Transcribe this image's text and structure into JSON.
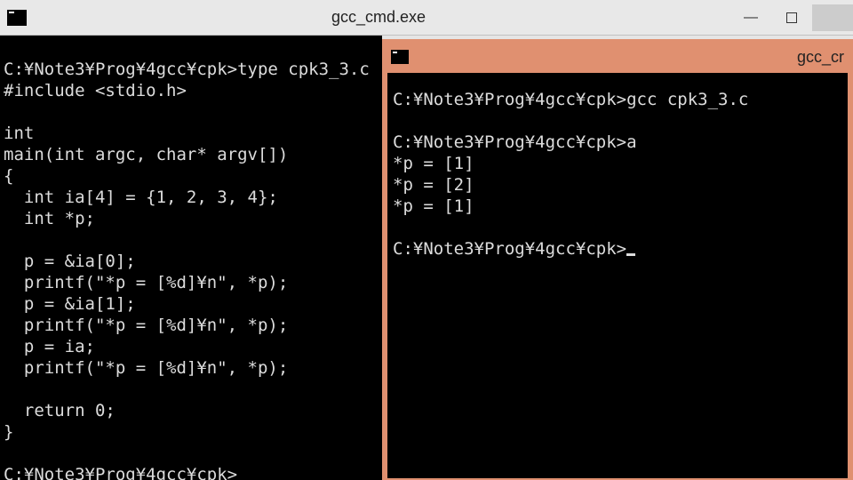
{
  "window1": {
    "title": "gcc_cmd.exe"
  },
  "window2": {
    "title": "gcc_cr"
  },
  "left": {
    "l0": "",
    "l1": "C:¥Note3¥Prog¥4gcc¥cpk>type cpk3_3.c",
    "l2": "#include <stdio.h>",
    "l3": "",
    "l4": "int",
    "l5": "main(int argc, char* argv[])",
    "l6": "{",
    "l7": "  int ia[4] = {1, 2, 3, 4};",
    "l8": "  int *p;",
    "l9": "",
    "l10": "  p = &ia[0];",
    "l11": "  printf(\"*p = [%d]¥n\", *p);",
    "l12": "  p = &ia[1];",
    "l13": "  printf(\"*p = [%d]¥n\", *p);",
    "l14": "  p = ia;",
    "l15": "  printf(\"*p = [%d]¥n\", *p);",
    "l16": "",
    "l17": "  return 0;",
    "l18": "}",
    "l19": "",
    "l20": "C:¥Note3¥Prog¥4gcc¥cpk>"
  },
  "right": {
    "l1": "C:¥Note3¥Prog¥4gcc¥cpk>gcc cpk3_3.c",
    "l2": "",
    "l3": "C:¥Note3¥Prog¥4gcc¥cpk>a",
    "l4": "*p = [1]",
    "l5": "*p = [2]",
    "l6": "*p = [1]",
    "l7": "",
    "l8": "C:¥Note3¥Prog¥4gcc¥cpk>"
  }
}
